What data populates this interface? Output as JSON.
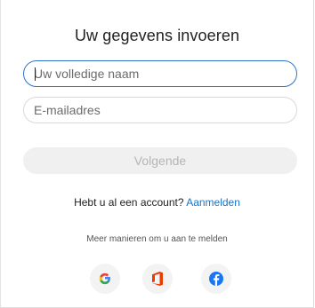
{
  "form": {
    "title": "Uw gegevens invoeren",
    "name_placeholder": "Uw volledige naam",
    "name_value": "",
    "email_placeholder": "E-mailadres",
    "email_value": "",
    "next_label": "Volgende"
  },
  "signin": {
    "prompt": "Hebt u al een account?",
    "link_label": "Aanmelden"
  },
  "alternatives": {
    "label": "Meer manieren om u aan te melden",
    "providers": [
      {
        "icon": "google-icon",
        "color": "#34a853"
      },
      {
        "icon": "office-icon",
        "color": "#eb3c00"
      },
      {
        "icon": "facebook-icon",
        "color": "#1877f2"
      }
    ]
  },
  "colors": {
    "accent": "#1a73c8",
    "focus_border": "#2f74c9",
    "disabled_button": "#f0f0f0"
  }
}
